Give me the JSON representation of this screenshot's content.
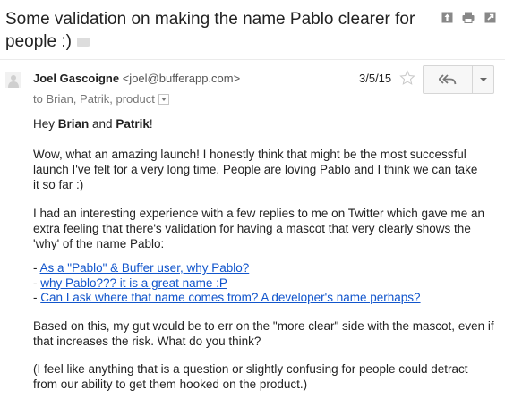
{
  "subject": {
    "text": "Some validation on making the name Pablo clearer for people :)"
  },
  "toolbar": {
    "icons": [
      "archive-icon",
      "print-icon",
      "new-window-icon"
    ]
  },
  "message": {
    "sender_name": "Joel Gascoigne",
    "sender_email": "<joel@bufferapp.com>",
    "to_text": "to Brian, Patrik, product",
    "date": "3/5/15",
    "greeting": {
      "prefix": "Hey ",
      "name1": "Brian",
      "and": " and ",
      "name2": "Patrik",
      "suffix": "!"
    },
    "paragraph1": "Wow, what an amazing launch! I honestly think that might be the most successful launch I've felt for a very long time. People are loving Pablo and I think we can take it so far :)",
    "paragraph2": "I had an interesting experience with a few replies to me on Twitter which gave me an extra feeling that there's validation for having a mascot that very clearly shows the 'why' of the name Pablo:",
    "link_prefix": "- ",
    "links": [
      "As a \"Pablo\" & Buffer user, why Pablo?",
      "why Pablo??? it is a great name :P",
      "Can I ask where that name comes from? A developer's name perhaps?"
    ],
    "paragraph3": "Based on this, my gut would be to err on the \"more clear\" side with the mascot, even if that increases the risk. What do you think?",
    "paragraph4": "(I feel like anything that is a question or slightly confusing for people could detract from our ability to get them hooked on the product.)"
  },
  "colors": {
    "link": "#1155cc",
    "text": "#222222",
    "muted": "#777777"
  }
}
